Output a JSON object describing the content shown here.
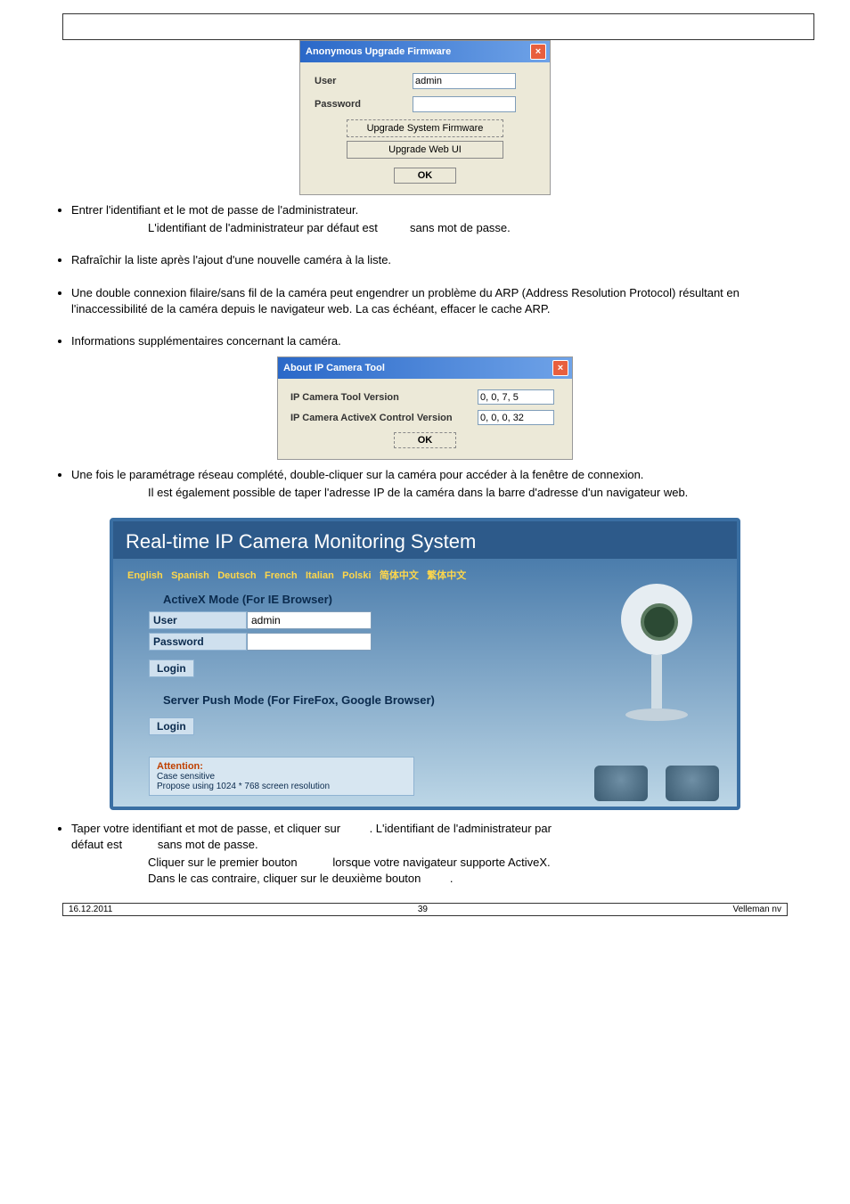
{
  "dialog_upgrade": {
    "title": "Anonymous Upgrade Firmware",
    "user_label": "User",
    "user_value": "admin",
    "password_label": "Password",
    "btn_upgrade_sys": "Upgrade System Firmware",
    "btn_upgrade_web": "Upgrade Web UI",
    "btn_ok": "OK"
  },
  "bullets": {
    "b1_line1": "Entrer l'identifiant et le mot de passe de l'administrateur.",
    "b1_note": "L'identifiant de l'administrateur par défaut est",
    "b1_note_cont": "sans mot de passe.",
    "b2": "Rafraîchir la liste après l'ajout d'une nouvelle caméra à la liste.",
    "b3": "Une double connexion filaire/sans fil de la caméra peut engendrer un problème du ARP (Address Resolution Protocol) résultant en l'inaccessibilité de la caméra depuis le navigateur web. La cas échéant, effacer le cache ARP.",
    "b4": "Informations supplémentaires concernant la caméra.",
    "b5_line1": "Une fois le paramétrage réseau complété, double-cliquer sur la caméra pour accéder à la fenêtre de connexion.",
    "b5_note": "Il est également possible de taper l'adresse IP de la caméra dans la barre d'adresse d'un navigateur web.",
    "b6_line1_a": "Taper votre identifiant et mot de passe, et cliquer sur",
    "b6_line1_b": ". L'identifiant de l'administrateur par",
    "b6_line2": "défaut est",
    "b6_line2_b": "sans mot de passe.",
    "b6_note1_a": "Cliquer sur le premier bouton",
    "b6_note1_b": "lorsque votre navigateur supporte ActiveX.",
    "b6_note2_a": "Dans le cas contraire, cliquer sur le deuxième bouton",
    "b6_note2_b": "."
  },
  "dialog_about": {
    "title": "About IP Camera Tool",
    "row1_label": "IP Camera Tool Version",
    "row1_value": "0, 0, 7, 5",
    "row2_label": "IP Camera ActiveX Control Version",
    "row2_value": "0, 0, 0, 32",
    "btn_ok": "OK"
  },
  "web_screenshot": {
    "title": "Real-time IP Camera Monitoring System",
    "langs": [
      "English",
      "Spanish",
      "Deutsch",
      "French",
      "Italian",
      "Polski",
      "简体中文",
      "繁体中文"
    ],
    "section_activex": "ActiveX Mode (For IE Browser)",
    "user_label": "User",
    "user_value": "admin",
    "password_label": "Password",
    "login": "Login",
    "section_push": "Server Push Mode (For FireFox, Google Browser)",
    "login2": "Login",
    "attention": "Attention:",
    "att_line1": "Case sensitive",
    "att_line2": "Propose using 1024 * 768 screen resolution"
  },
  "footer": {
    "left": "16.12.2011",
    "center": "39",
    "right": "Velleman nv"
  }
}
